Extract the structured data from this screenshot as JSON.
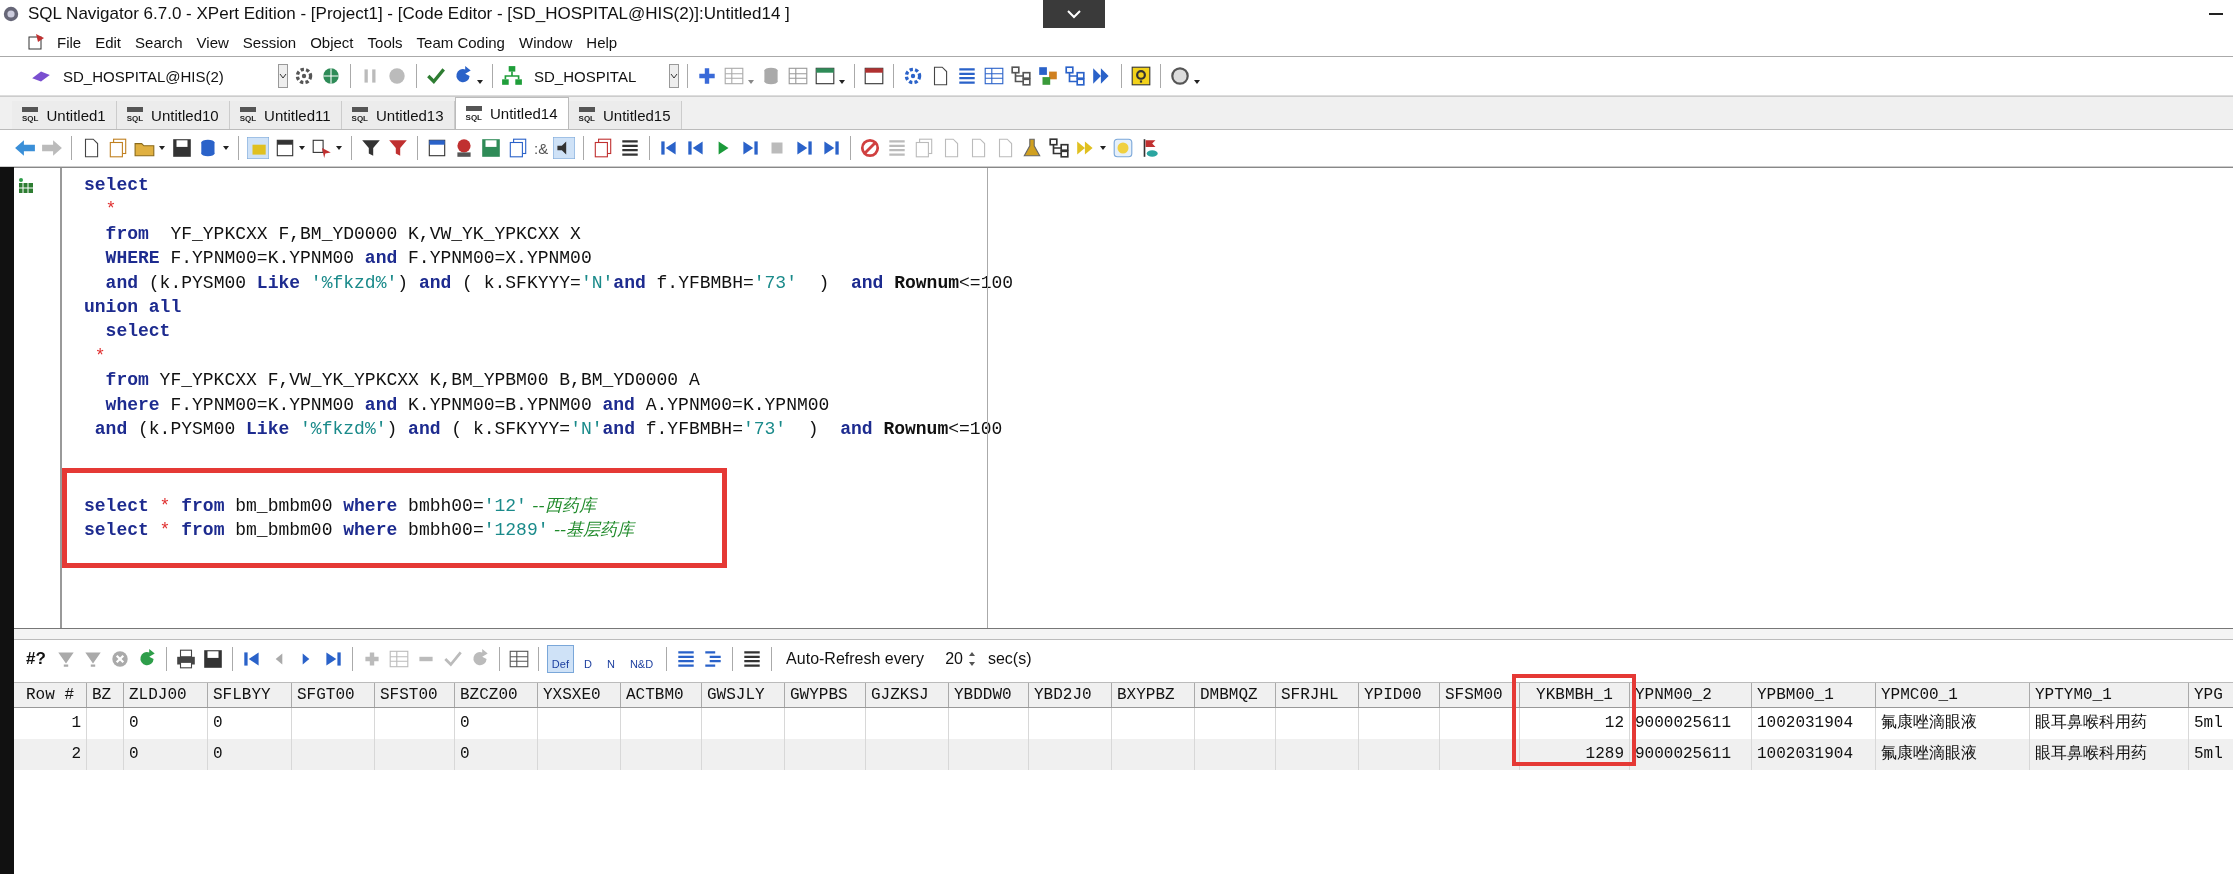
{
  "window": {
    "title": "SQL Navigator 6.7.0 - XPert Edition - [Project1] - [Code Editor - [SD_HOSPITAL@HIS(2)]:Untitled14 ]"
  },
  "menu": [
    "File",
    "Edit",
    "Search",
    "View",
    "Session",
    "Object",
    "Tools",
    "Team Coding",
    "Window",
    "Help"
  ],
  "toolbar": {
    "connection": "SD_HOSPITAL@HIS(2)",
    "schema": "SD_HOSPITAL"
  },
  "tabs": [
    {
      "label": "Untitled1",
      "icon_label": "SQL",
      "selected": false
    },
    {
      "label": "Untitled10",
      "icon_label": "SQL",
      "selected": false
    },
    {
      "label": "Untitled11",
      "icon_label": "SQL",
      "selected": false
    },
    {
      "label": "Untitled13",
      "icon_label": "SQL",
      "selected": false
    },
    {
      "label": "Untitled14",
      "icon_label": "SQL",
      "selected": true
    },
    {
      "label": "Untitled15",
      "icon_label": "SQL",
      "selected": false
    }
  ],
  "editor_toolbar": {
    "parameter_label": ":&"
  },
  "code": {
    "boxed": true,
    "lines": [
      [
        {
          "kind": "kw",
          "text": "select"
        }
      ],
      [
        {
          "kind": "op",
          "text": "  *"
        }
      ],
      [
        {
          "kind": "kw",
          "text": "  from"
        },
        {
          "kind": "plain",
          "text": "  YF_YPKCXX F,BM_YD0000 K,VW_YK_YPKCXX X"
        }
      ],
      [
        {
          "kind": "kw",
          "text": "  WHERE"
        },
        {
          "kind": "plain",
          "text": " F.YPNM00=K.YPNM00 "
        },
        {
          "kind": "kw",
          "text": "and"
        },
        {
          "kind": "plain",
          "text": " F.YPNM00=X.YPNM00"
        }
      ],
      [
        {
          "kind": "kw",
          "text": "  and"
        },
        {
          "kind": "plain",
          "text": " (k.PYSM00 "
        },
        {
          "kind": "kw",
          "text": "Like"
        },
        {
          "kind": "str",
          "text": " '%fkzd%'"
        },
        {
          "kind": "plain",
          "text": ") "
        },
        {
          "kind": "kw",
          "text": "and"
        },
        {
          "kind": "plain",
          "text": " ( k.SFKYYY="
        },
        {
          "kind": "str",
          "text": "'N'"
        },
        {
          "kind": "kw",
          "text": "and"
        },
        {
          "kind": "plain",
          "text": " f.YFBMBH="
        },
        {
          "kind": "str",
          "text": "'73'"
        },
        {
          "kind": "plain",
          "text": "  )  "
        },
        {
          "kind": "kw",
          "text": "and"
        },
        {
          "kind": "strong",
          "text": " Rownum"
        },
        {
          "kind": "plain",
          "text": "<=100"
        }
      ],
      [
        {
          "kind": "kw",
          "text": "union all"
        }
      ],
      [
        {
          "kind": "kw",
          "text": "  select"
        }
      ],
      [
        {
          "kind": "op",
          "text": " *"
        }
      ],
      [
        {
          "kind": "kw",
          "text": "  from"
        },
        {
          "kind": "plain",
          "text": " YF_YPKCXX F,VW_YK_YPKCXX K,BM_YPBM00 B,BM_YD0000 A"
        }
      ],
      [
        {
          "kind": "kw",
          "text": "  where"
        },
        {
          "kind": "plain",
          "text": " F.YPNM00=K.YPNM00 "
        },
        {
          "kind": "kw",
          "text": "and"
        },
        {
          "kind": "plain",
          "text": " K.YPNM00=B.YPNM00 "
        },
        {
          "kind": "kw",
          "text": "and"
        },
        {
          "kind": "plain",
          "text": " A.YPNM00=K.YPNM00"
        }
      ],
      [
        {
          "kind": "kw",
          "text": " and"
        },
        {
          "kind": "plain",
          "text": " (k.PYSM00 "
        },
        {
          "kind": "kw",
          "text": "Like"
        },
        {
          "kind": "str",
          "text": " '%fkzd%'"
        },
        {
          "kind": "plain",
          "text": ") "
        },
        {
          "kind": "kw",
          "text": "and"
        },
        {
          "kind": "plain",
          "text": " ( k.SFKYYY="
        },
        {
          "kind": "str",
          "text": "'N'"
        },
        {
          "kind": "kw",
          "text": "and"
        },
        {
          "kind": "plain",
          "text": " f.YFBMBH="
        },
        {
          "kind": "str",
          "text": "'73'"
        },
        {
          "kind": "plain",
          "text": "  )  "
        },
        {
          "kind": "kw",
          "text": "and"
        },
        {
          "kind": "strong",
          "text": " Rownum"
        },
        {
          "kind": "plain",
          "text": "<=100"
        }
      ]
    ],
    "boxed_lines": [
      [
        {
          "kind": "kw",
          "text": "select"
        },
        {
          "kind": "op",
          "text": " *"
        },
        {
          "kind": "kw",
          "text": " from"
        },
        {
          "kind": "plain",
          "text": " bm_bmbm00 "
        },
        {
          "kind": "kw",
          "text": "where"
        },
        {
          "kind": "plain",
          "text": " bmbh00="
        },
        {
          "kind": "str",
          "text": "'12'"
        },
        {
          "kind": "comment",
          "text": " --西药库"
        }
      ],
      [
        {
          "kind": "kw",
          "text": "select"
        },
        {
          "kind": "op",
          "text": " *"
        },
        {
          "kind": "kw",
          "text": " from"
        },
        {
          "kind": "plain",
          "text": " bm_bmbm00 "
        },
        {
          "kind": "kw",
          "text": "where"
        },
        {
          "kind": "plain",
          "text": " bmbh00="
        },
        {
          "kind": "str",
          "text": "'1289'"
        },
        {
          "kind": "comment",
          "text": " --基层药库"
        }
      ]
    ]
  },
  "results_toolbar": {
    "label": "#?",
    "view_modes": [
      {
        "label": "Def",
        "selected": true
      },
      {
        "label": "D",
        "selected": false
      },
      {
        "label": "N",
        "selected": false
      },
      {
        "label": "N&D",
        "selected": false
      }
    ],
    "auto_refresh_label": "Auto-Refresh every",
    "interval": "20",
    "unit": "sec(s)"
  },
  "grid": {
    "columns": [
      {
        "label": "Row #",
        "numeric": true,
        "boxed": false
      },
      {
        "label": "BZ",
        "numeric": false,
        "boxed": false
      },
      {
        "label": "ZLDJ00",
        "numeric": false,
        "boxed": false
      },
      {
        "label": "SFLBYY",
        "numeric": false,
        "boxed": false
      },
      {
        "label": "SFGT00",
        "numeric": false,
        "boxed": false
      },
      {
        "label": "SFST00",
        "numeric": false,
        "boxed": false
      },
      {
        "label": "BZCZ00",
        "numeric": false,
        "boxed": false
      },
      {
        "label": "YXSXE0",
        "numeric": false,
        "boxed": false
      },
      {
        "label": "ACTBM0",
        "numeric": false,
        "boxed": false
      },
      {
        "label": "GWSJLY",
        "numeric": false,
        "boxed": false
      },
      {
        "label": "GWYPBS",
        "numeric": false,
        "boxed": false
      },
      {
        "label": "GJZKSJ",
        "numeric": false,
        "boxed": false
      },
      {
        "label": "YBDDW0",
        "numeric": false,
        "boxed": false
      },
      {
        "label": "YBD2J0",
        "numeric": false,
        "boxed": false
      },
      {
        "label": "BXYPBZ",
        "numeric": false,
        "boxed": false
      },
      {
        "label": "DMBMQZ",
        "numeric": false,
        "boxed": false
      },
      {
        "label": "SFRJHL",
        "numeric": false,
        "boxed": false
      },
      {
        "label": "YPID00",
        "numeric": false,
        "boxed": false
      },
      {
        "label": "SFSM00",
        "numeric": false,
        "boxed": false
      },
      {
        "label": "YKBMBH_1",
        "numeric": true,
        "boxed": true
      },
      {
        "label": "YPNM00_2",
        "numeric": false,
        "boxed": false
      },
      {
        "label": "YPBM00_1",
        "numeric": false,
        "boxed": false
      },
      {
        "label": "YPMC00_1",
        "numeric": false,
        "boxed": false
      },
      {
        "label": "YPTYM0_1",
        "numeric": false,
        "boxed": false
      },
      {
        "label": "YPG",
        "numeric": false,
        "boxed": false
      }
    ],
    "rows": [
      {
        "cells": {
          "0": "1",
          "2": "0",
          "3": "0",
          "6": "0",
          "19": "12",
          "20": "9000025611",
          "21": "1002031904",
          "22": "氟康唑滴眼液",
          "23": "眼耳鼻喉科用药",
          "24": "5ml"
        }
      },
      {
        "cells": {
          "0": "2",
          "2": "0",
          "3": "0",
          "6": "0",
          "19": "1289",
          "20": "9000025611",
          "21": "1002031904",
          "22": "氟康唑滴眼液",
          "23": "眼耳鼻喉科用药",
          "24": "5ml"
        }
      }
    ]
  }
}
